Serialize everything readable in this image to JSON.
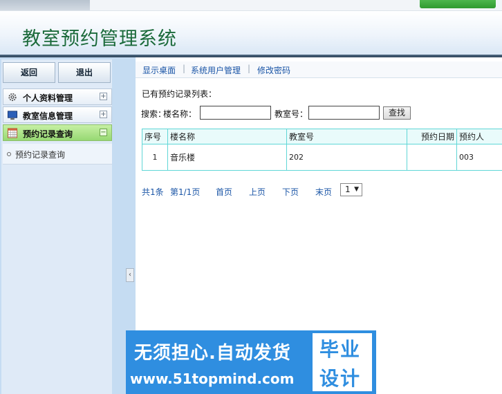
{
  "app": {
    "title": "教室预约管理系统"
  },
  "sidebar": {
    "back_label": "返回",
    "quit_label": "退出",
    "menus": [
      {
        "label": "个人资料管理",
        "toggle": "+"
      },
      {
        "label": "教室信息管理",
        "toggle": "+"
      },
      {
        "label": "预约记录查询",
        "toggle": "−"
      }
    ],
    "submenu": {
      "label": "预约记录查询"
    }
  },
  "nav": {
    "items": [
      "显示桌面",
      "系统用户管理",
      "修改密码"
    ],
    "separator": "|"
  },
  "main": {
    "list_title": "已有预约记录列表：",
    "search": {
      "prefix": "搜索：",
      "building_label": "楼名称：",
      "building_value": "",
      "room_label": "教室号：",
      "room_value": "",
      "button_label": "查找"
    },
    "table": {
      "headers": [
        "序号",
        "楼名称",
        "教室号",
        "预约日期",
        "预约人"
      ],
      "rows": [
        [
          "1",
          "音乐楼",
          "202",
          "",
          "003"
        ]
      ]
    },
    "pager": {
      "total": "共1条",
      "page": "第1/1页",
      "first": "首页",
      "prev": "上页",
      "next": "下页",
      "last": "末页",
      "selected": "1"
    }
  },
  "banner": {
    "line1": "无须担心.自动发货",
    "line2": "www.51topmind.com",
    "box_top": "毕业",
    "box_bottom": "设计"
  },
  "colors": {
    "accent_green": "#1b6a3a",
    "link_blue": "#1a55a6",
    "table_border": "#5fd6d6",
    "banner_blue": "#2f8ee0"
  }
}
